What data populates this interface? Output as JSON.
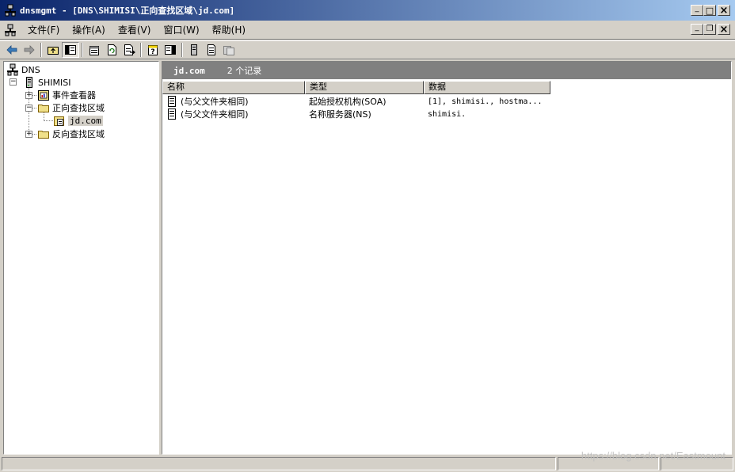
{
  "window": {
    "title": "dnsmgmt - [DNS\\SHIMISI\\正向查找区域\\jd.com]",
    "minimize_glyph": "_",
    "maximize_glyph": "□",
    "close_glyph": "×"
  },
  "menu": {
    "items": [
      "文件(F)",
      "操作(A)",
      "查看(V)",
      "窗口(W)",
      "帮助(H)"
    ],
    "mdi_minimize_glyph": "_",
    "mdi_restore_glyph": "❐",
    "mdi_close_glyph": "×"
  },
  "toolbar": {
    "buttons": [
      "back-icon",
      "forward-icon",
      "up-folder-icon",
      "show-hide-tree-icon",
      "properties-icon",
      "refresh-icon",
      "export-list-icon",
      "help-icon",
      "action-pane-icon",
      "new-record-icon",
      "new-alias-icon",
      "new-domain-icon"
    ]
  },
  "tree": {
    "root": "DNS",
    "server": "SHIMISI",
    "event_viewer": "事件查看器",
    "forward_zones": "正向查找区域",
    "zone": "jd.com",
    "reverse_zones": "反向查找区域",
    "expanded_glyph": "−",
    "collapsed_glyph": "+"
  },
  "details": {
    "band_title": "jd.com",
    "band_count": "2 个记录",
    "columns": [
      "名称",
      "类型",
      "数据"
    ],
    "rows": [
      {
        "name": "(与父文件夹相同)",
        "type": "起始授权机构(SOA)",
        "data": "[1], shimisi., hostma..."
      },
      {
        "name": "(与父文件夹相同)",
        "type": "名称服务器(NS)",
        "data": "shimisi."
      }
    ]
  },
  "watermark": "https://blog.csdn.net/Eastmount",
  "colors": {
    "title_gradient_start": "#0a246a",
    "title_gradient_end": "#a6caf0",
    "band": "#808080",
    "chrome": "#d4d0c8"
  }
}
